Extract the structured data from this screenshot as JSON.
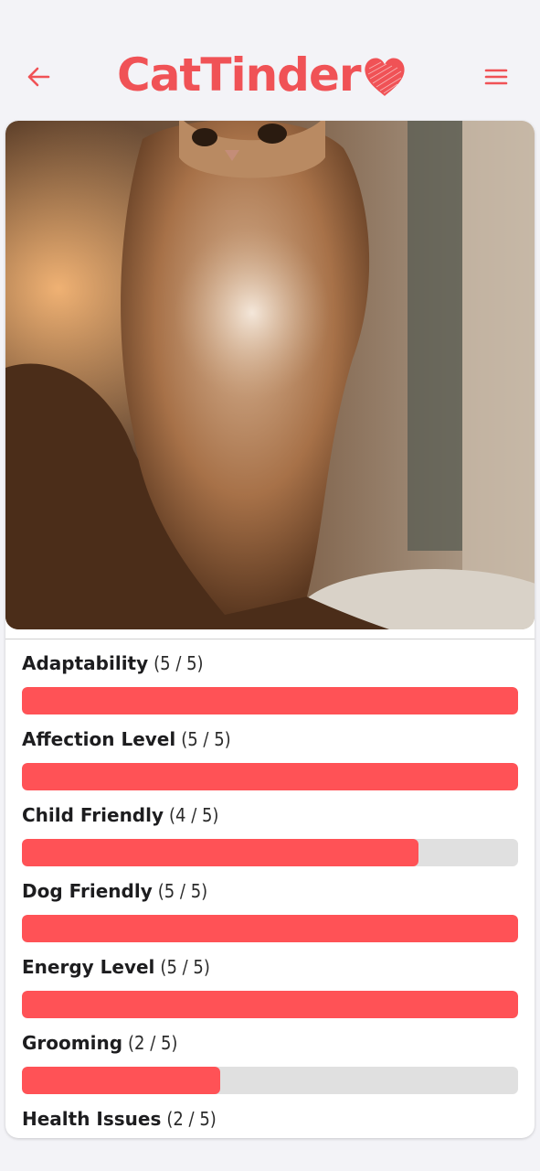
{
  "header": {
    "logo_text": "CatTinder",
    "back_icon": "arrow-left-icon",
    "menu_icon": "hamburger-menu-icon",
    "logo_icon": "heart-icon"
  },
  "colors": {
    "brand": "#f05256",
    "bar_fill": "#ff5256",
    "bar_track": "#e0e0e0"
  },
  "stats": [
    {
      "name": "Adaptability",
      "score": "(5 / 5)",
      "value": 5,
      "max": 5
    },
    {
      "name": "Affection Level",
      "score": "(5 / 5)",
      "value": 5,
      "max": 5
    },
    {
      "name": "Child Friendly",
      "score": "(4 / 5)",
      "value": 4,
      "max": 5
    },
    {
      "name": "Dog Friendly",
      "score": "(5 / 5)",
      "value": 5,
      "max": 5
    },
    {
      "name": "Energy Level",
      "score": "(5 / 5)",
      "value": 5,
      "max": 5
    },
    {
      "name": "Grooming",
      "score": "(2 / 5)",
      "value": 2,
      "max": 5
    },
    {
      "name": "Health Issues",
      "score": "(2 / 5)",
      "value": 2,
      "max": 5
    }
  ]
}
